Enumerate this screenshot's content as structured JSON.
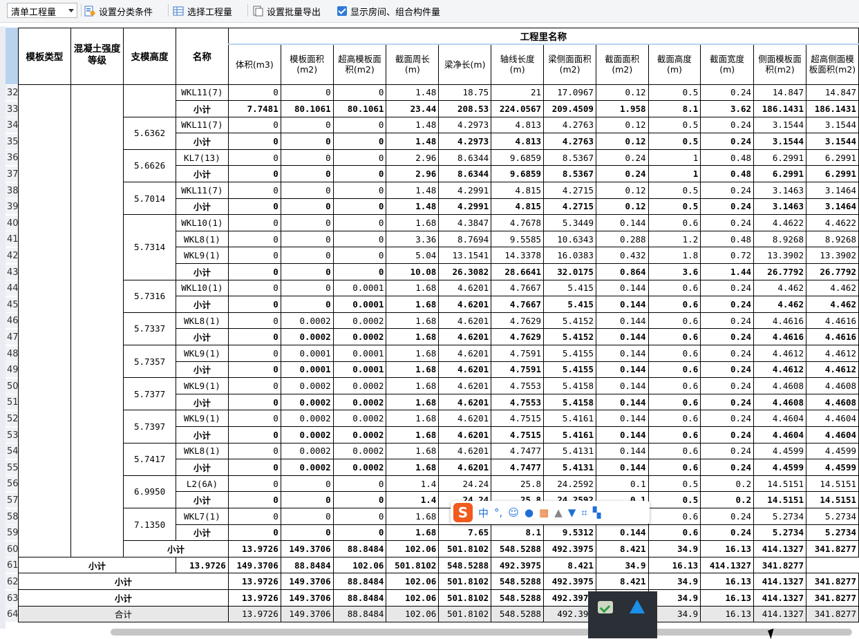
{
  "toolbar": {
    "select_value": "清单工程量",
    "set_category": "设置分类条件",
    "select_quantity": "选择工程量",
    "batch_export": "设置批量导出",
    "show_rooms": "显示房间、组合构件量"
  },
  "header": {
    "c0": "模板类型",
    "c1": "混凝土强度等级",
    "c2": "支模高度",
    "c3": "名称",
    "group": "工程里名称",
    "q": [
      "体积(m3)",
      "模板面积(m2)",
      "超高模板面积(m2)",
      "截面周长(m)",
      "梁净长(m)",
      "轴线长度(m)",
      "梁侧面面积(m2)",
      "截面面积(m2)",
      "截面高度(m)",
      "截面宽度(m)",
      "侧面模板面积(m2)",
      "超高侧面模板面积(m2)"
    ]
  },
  "rows": [
    {
      "n": "32",
      "h": "",
      "name": "WKL11(7)",
      "sub": false,
      "v": [
        "0",
        "0",
        "0",
        "1.48",
        "18.75",
        "21",
        "17.0967",
        "0.12",
        "0.5",
        "0.24",
        "14.847",
        "14.847"
      ]
    },
    {
      "n": "33",
      "h": "",
      "name": "小计",
      "sub": true,
      "v": [
        "7.7481",
        "80.1061",
        "80.1061",
        "23.44",
        "208.53",
        "224.0567",
        "209.4509",
        "1.958",
        "8.1",
        "3.62",
        "186.1431",
        "186.1431"
      ]
    },
    {
      "n": "34",
      "h": "5.6362",
      "name": "WKL11(7)",
      "sub": false,
      "v": [
        "0",
        "0",
        "0",
        "1.48",
        "4.2973",
        "4.813",
        "4.2763",
        "0.12",
        "0.5",
        "0.24",
        "3.1544",
        "3.1544"
      ]
    },
    {
      "n": "35",
      "h": "",
      "name": "小计",
      "sub": true,
      "v": [
        "0",
        "0",
        "0",
        "1.48",
        "4.2973",
        "4.813",
        "4.2763",
        "0.12",
        "0.5",
        "0.24",
        "3.1544",
        "3.1544"
      ]
    },
    {
      "n": "36",
      "h": "5.6626",
      "name": "KL7(13)",
      "sub": false,
      "v": [
        "0",
        "0",
        "0",
        "2.96",
        "8.6344",
        "9.6859",
        "8.5367",
        "0.24",
        "1",
        "0.48",
        "6.2991",
        "6.2991"
      ]
    },
    {
      "n": "37",
      "h": "",
      "name": "小计",
      "sub": true,
      "v": [
        "0",
        "0",
        "0",
        "2.96",
        "8.6344",
        "9.6859",
        "8.5367",
        "0.24",
        "1",
        "0.48",
        "6.2991",
        "6.2991"
      ]
    },
    {
      "n": "38",
      "h": "5.7014",
      "name": "WKL11(7)",
      "sub": false,
      "v": [
        "0",
        "0",
        "0",
        "1.48",
        "4.2991",
        "4.815",
        "4.2715",
        "0.12",
        "0.5",
        "0.24",
        "3.1463",
        "3.1464"
      ]
    },
    {
      "n": "39",
      "h": "",
      "name": "小计",
      "sub": true,
      "v": [
        "0",
        "0",
        "0",
        "1.48",
        "4.2991",
        "4.815",
        "4.2715",
        "0.12",
        "0.5",
        "0.24",
        "3.1463",
        "3.1464"
      ]
    },
    {
      "n": "40",
      "h": "5.7314",
      "name": "WKL10(1)",
      "sub": false,
      "v": [
        "0",
        "0",
        "0",
        "1.68",
        "4.3847",
        "4.7678",
        "5.3449",
        "0.144",
        "0.6",
        "0.24",
        "4.4622",
        "4.4622"
      ]
    },
    {
      "n": "41",
      "h": "",
      "name": "WKL8(1)",
      "sub": false,
      "v": [
        "0",
        "0",
        "0",
        "3.36",
        "8.7694",
        "9.5585",
        "10.6343",
        "0.288",
        "1.2",
        "0.48",
        "8.9268",
        "8.9268"
      ]
    },
    {
      "n": "42",
      "h": "",
      "name": "WKL9(1)",
      "sub": false,
      "v": [
        "0",
        "0",
        "0",
        "5.04",
        "13.1541",
        "14.3378",
        "16.0383",
        "0.432",
        "1.8",
        "0.72",
        "13.3902",
        "13.3902"
      ]
    },
    {
      "n": "43",
      "h": "",
      "name": "小计",
      "sub": true,
      "v": [
        "0",
        "0",
        "0",
        "10.08",
        "26.3082",
        "28.6641",
        "32.0175",
        "0.864",
        "3.6",
        "1.44",
        "26.7792",
        "26.7792"
      ]
    },
    {
      "n": "44",
      "h": "5.7316",
      "name": "WKL10(1)",
      "sub": false,
      "v": [
        "0",
        "0",
        "0.0001",
        "1.68",
        "4.6201",
        "4.7667",
        "5.415",
        "0.144",
        "0.6",
        "0.24",
        "4.462",
        "4.462"
      ]
    },
    {
      "n": "45",
      "h": "",
      "name": "小计",
      "sub": true,
      "v": [
        "0",
        "0",
        "0.0001",
        "1.68",
        "4.6201",
        "4.7667",
        "5.415",
        "0.144",
        "0.6",
        "0.24",
        "4.462",
        "4.462"
      ]
    },
    {
      "n": "46",
      "h": "5.7337",
      "name": "WKL8(1)",
      "sub": false,
      "v": [
        "0",
        "0.0002",
        "0.0002",
        "1.68",
        "4.6201",
        "4.7629",
        "5.4152",
        "0.144",
        "0.6",
        "0.24",
        "4.4616",
        "4.4616"
      ]
    },
    {
      "n": "47",
      "h": "",
      "name": "小计",
      "sub": true,
      "v": [
        "0",
        "0.0002",
        "0.0002",
        "1.68",
        "4.6201",
        "4.7629",
        "5.4152",
        "0.144",
        "0.6",
        "0.24",
        "4.4616",
        "4.4616"
      ]
    },
    {
      "n": "48",
      "h": "5.7357",
      "name": "WKL9(1)",
      "sub": false,
      "v": [
        "0",
        "0.0001",
        "0.0001",
        "1.68",
        "4.6201",
        "4.7591",
        "5.4155",
        "0.144",
        "0.6",
        "0.24",
        "4.4612",
        "4.4612"
      ]
    },
    {
      "n": "49",
      "h": "",
      "name": "小计",
      "sub": true,
      "v": [
        "0",
        "0.0001",
        "0.0001",
        "1.68",
        "4.6201",
        "4.7591",
        "5.4155",
        "0.144",
        "0.6",
        "0.24",
        "4.4612",
        "4.4612"
      ]
    },
    {
      "n": "50",
      "h": "5.7377",
      "name": "WKL9(1)",
      "sub": false,
      "v": [
        "0",
        "0.0002",
        "0.0002",
        "1.68",
        "4.6201",
        "4.7553",
        "5.4158",
        "0.144",
        "0.6",
        "0.24",
        "4.4608",
        "4.4608"
      ]
    },
    {
      "n": "51",
      "h": "",
      "name": "小计",
      "sub": true,
      "v": [
        "0",
        "0.0002",
        "0.0002",
        "1.68",
        "4.6201",
        "4.7553",
        "5.4158",
        "0.144",
        "0.6",
        "0.24",
        "4.4608",
        "4.4608"
      ]
    },
    {
      "n": "52",
      "h": "5.7397",
      "name": "WKL9(1)",
      "sub": false,
      "v": [
        "0",
        "0.0002",
        "0.0002",
        "1.68",
        "4.6201",
        "4.7515",
        "5.4161",
        "0.144",
        "0.6",
        "0.24",
        "4.4604",
        "4.4604"
      ]
    },
    {
      "n": "53",
      "h": "",
      "name": "小计",
      "sub": true,
      "v": [
        "0",
        "0.0002",
        "0.0002",
        "1.68",
        "4.6201",
        "4.7515",
        "5.4161",
        "0.144",
        "0.6",
        "0.24",
        "4.4604",
        "4.4604"
      ]
    },
    {
      "n": "54",
      "h": "5.7417",
      "name": "WKL8(1)",
      "sub": false,
      "v": [
        "0",
        "0.0002",
        "0.0002",
        "1.68",
        "4.6201",
        "4.7477",
        "5.4131",
        "0.144",
        "0.6",
        "0.24",
        "4.4599",
        "4.4599"
      ]
    },
    {
      "n": "55",
      "h": "",
      "name": "小计",
      "sub": true,
      "v": [
        "0",
        "0.0002",
        "0.0002",
        "1.68",
        "4.6201",
        "4.7477",
        "5.4131",
        "0.144",
        "0.6",
        "0.24",
        "4.4599",
        "4.4599"
      ]
    },
    {
      "n": "56",
      "h": "6.9950",
      "name": "L2(6A)",
      "sub": false,
      "v": [
        "0",
        "0",
        "0",
        "1.4",
        "24.24",
        "25.8",
        "24.2592",
        "0.1",
        "0.5",
        "0.2",
        "14.5151",
        "14.5151"
      ]
    },
    {
      "n": "57",
      "h": "",
      "name": "小计",
      "sub": true,
      "v": [
        "0",
        "0",
        "0",
        "1.4",
        "24.24",
        "25.8",
        "24.2592",
        "0.1",
        "0.5",
        "0.2",
        "14.5151",
        "14.5151"
      ]
    },
    {
      "n": "58",
      "h": "7.1350",
      "name": "WKL7(1)",
      "sub": false,
      "v": [
        "0",
        "0",
        "0",
        "1.68",
        "",
        "",
        "",
        "",
        "0.6",
        "0.24",
        "5.2734",
        "5.2734"
      ]
    },
    {
      "n": "59",
      "h": "",
      "name": "小计",
      "sub": true,
      "v": [
        "0",
        "0",
        "0",
        "1.68",
        "7.65",
        "8.1",
        "9.5312",
        "0.144",
        "0.6",
        "0.24",
        "5.2734",
        "5.2734"
      ]
    }
  ],
  "subtotal_label": "小计",
  "subtotal_values": [
    "13.9726",
    "149.3706",
    "88.8484",
    "102.06",
    "501.8102",
    "548.5288",
    "492.3975",
    "8.421",
    "34.9",
    "16.13",
    "414.1327",
    "341.8277"
  ],
  "subtotal_rows": [
    "60",
    "61",
    "62",
    "63"
  ],
  "total": {
    "n": "64",
    "label": "合计",
    "v": [
      "13.9726",
      "149.3706",
      "88.8484",
      "102.06",
      "501.8102",
      "548.5288",
      "492.397",
      "",
      "34.9",
      "16.13",
      "414.1327",
      "341.8277"
    ]
  },
  "ime": {
    "lang": "中",
    "punct": "°,"
  }
}
